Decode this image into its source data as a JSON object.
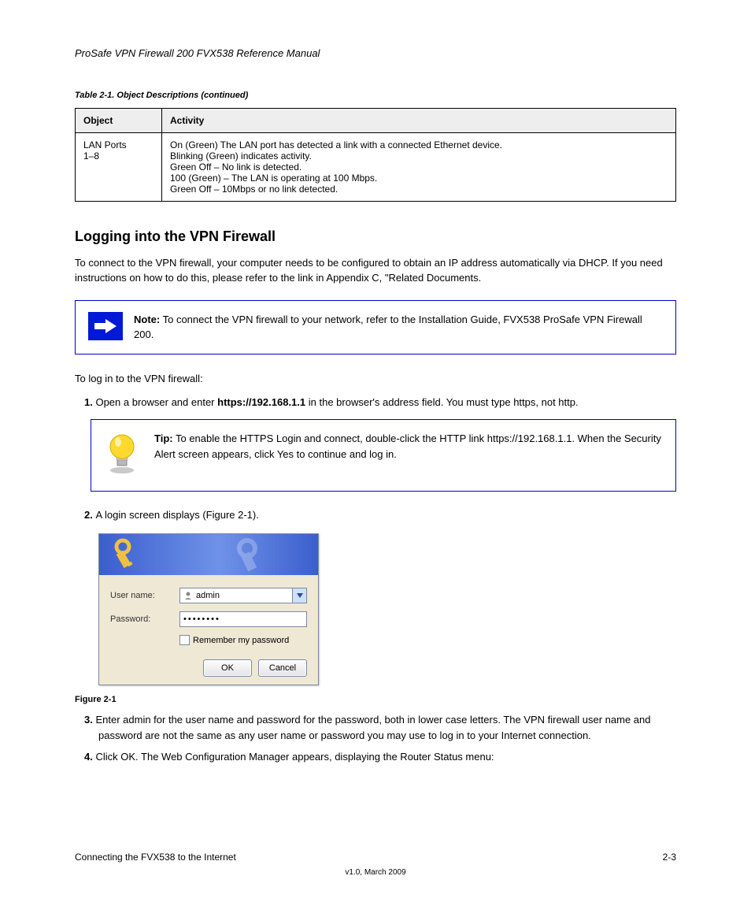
{
  "header": {
    "left": "ProSafe VPN Firewall 200 FVX538 Reference Manual",
    "right": ""
  },
  "table": {
    "preheader": "Table 2-1. Object Descriptions (continued)",
    "cols": [
      "Object",
      "Activity"
    ],
    "row": {
      "object": "LAN Ports\n1–8",
      "activity_lines": [
        "On (Green) The LAN port has detected a link with a connected Ethernet device.",
        "Blinking (Green) indicates activity.",
        "Green Off – No link is detected.",
        "100 (Green) – The LAN is operating at 100 Mbps.",
        "Green Off – 10Mbps or no link detected."
      ]
    }
  },
  "section": {
    "title": "Logging into the VPN Firewall"
  },
  "intro": "To connect to the VPN firewall, your computer needs to be configured to obtain an IP address automatically via DHCP. If you need instructions on how to do this, please refer to the link in Appendix C, \"Related Documents.",
  "note": {
    "title": "Note:",
    "text": "To connect the VPN firewall to your network, refer to the Installation Guide, FVX538 ProSafe VPN Firewall 200."
  },
  "steps": {
    "lead": "To log in to the VPN firewall:",
    "step1_a": "Open a browser and enter ",
    "step1_url": "https://192.168.1.1",
    "step1_b": " in the browser's address field. You must type https, not http.",
    "step2": "A login screen displays (Figure 2-1).",
    "step3": "Enter admin for the user name and password for the password, both in lower case letters. The VPN firewall user name and password are not the same as any user name or password you may use to log in to your Internet connection.",
    "step4": "Click OK. The Web Configuration Manager appears, displaying the Router Status menu:"
  },
  "tip": {
    "title": "Tip:",
    "text": "To enable the HTTPS Login and connect, double-click the HTTP link https://192.168.1.1.  When the Security Alert screen appears, click Yes to continue and log in."
  },
  "login": {
    "username_label": "User name:",
    "password_label": "Password:",
    "username_value": "admin",
    "password_mask": "••••••••",
    "remember": "Remember my password",
    "ok": "OK",
    "cancel": "Cancel"
  },
  "caption": "Figure 2-1",
  "footer": {
    "left": "Connecting the FVX538 to the Internet",
    "right": "2-3",
    "small": "v1.0, March 2009"
  }
}
